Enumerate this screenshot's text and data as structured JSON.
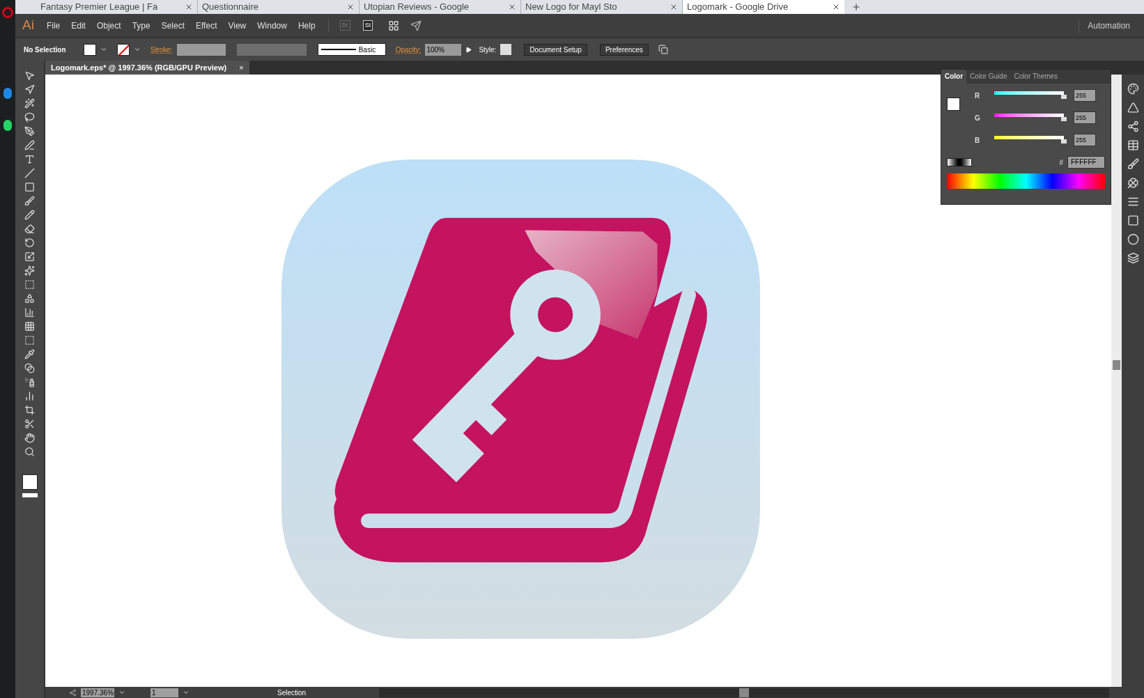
{
  "browser_tabs": [
    {
      "title": "Fantasy Premier League | Fa",
      "selected": false
    },
    {
      "title": "Questionnaire",
      "selected": false
    },
    {
      "title": "Utopian Reviews - Google",
      "selected": false
    },
    {
      "title": "New Logo for Mayl     Sto",
      "selected": false
    },
    {
      "title": "Logomark - Google Drive",
      "selected": true
    }
  ],
  "app_bar": {
    "logo": "Ai",
    "menu": [
      "File",
      "Edit",
      "Object",
      "Type",
      "Select",
      "Effect",
      "View",
      "Window",
      "Help"
    ],
    "bridge": "Br",
    "stock": "St",
    "workspace": "Automation"
  },
  "control_bar": {
    "selection": "No Selection",
    "stroke_label": "Stroke:",
    "stroke_profile": "Basic",
    "opacity_label": "Opacity:",
    "opacity": "100%",
    "style_label": "Style:",
    "buttons": [
      "Document Setup",
      "Preferences"
    ]
  },
  "document_tab": {
    "title": "Logomark.eps* @ 1997.36% (RGB/GPU Preview)",
    "close": "×"
  },
  "color_panel": {
    "tabs": [
      {
        "label": "Color",
        "selected": true
      },
      {
        "label": "Color Guide",
        "selected": false
      },
      {
        "label": "Color Themes",
        "selected": false
      }
    ],
    "channels": [
      {
        "name": "R",
        "level": 1,
        "value": "255"
      },
      {
        "name": "G",
        "level": 1,
        "value": "255"
      },
      {
        "name": "B",
        "level": 1,
        "value": "255"
      }
    ],
    "hex_label": "#",
    "hex": "FFFFFF"
  },
  "status_bar": {
    "zoom": "1997.36%",
    "page": "1",
    "status": "Selection"
  }
}
